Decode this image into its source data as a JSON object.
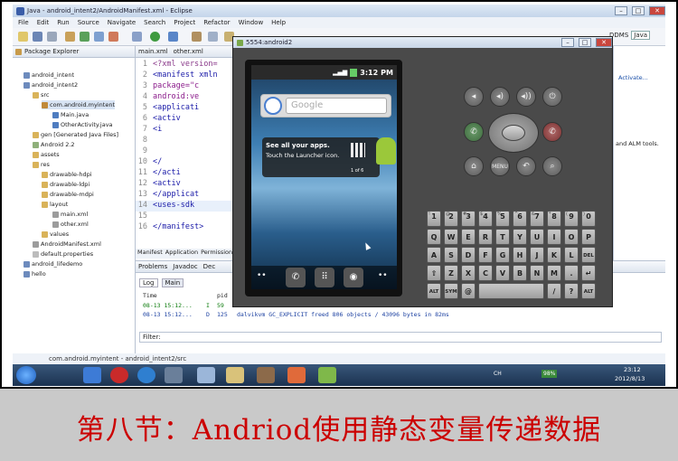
{
  "window": {
    "title": "Java - android_intent2/AndroidManifest.xml - Eclipse"
  },
  "menu": [
    "File",
    "Edit",
    "Run",
    "Source",
    "Navigate",
    "Search",
    "Project",
    "Refactor",
    "Window",
    "Help"
  ],
  "perspectives": {
    "ddms": "DDMS",
    "java": "Java"
  },
  "package_explorer": {
    "title": "Package Explorer",
    "items": [
      "android_intent",
      "android_intent2",
      "src",
      "com.android.myintent",
      "Main.java",
      "OtherActivity.java",
      "gen [Generated Java Files]",
      "Android 2.2",
      "assets",
      "res",
      "drawable-hdpi",
      "drawable-ldpi",
      "drawable-mdpi",
      "layout",
      "main.xml",
      "other.xml",
      "values",
      "AndroidManifest.xml",
      "default.properties",
      "android_lifedemo",
      "hello"
    ]
  },
  "editor": {
    "tabs": [
      "main.xml",
      "other.xml"
    ],
    "lines": [
      {
        "n": "1",
        "t": "<?xml version="
      },
      {
        "n": "2",
        "t": "<manifest xmln"
      },
      {
        "n": "3",
        "t": "    package=\"c"
      },
      {
        "n": "4",
        "t": "    android:ve"
      },
      {
        "n": "5",
        "t": "    <applicati"
      },
      {
        "n": "6",
        "t": "        <activ"
      },
      {
        "n": "7",
        "t": "            <i"
      },
      {
        "n": "8",
        "t": ""
      },
      {
        "n": "9",
        "t": ""
      },
      {
        "n": "10",
        "t": "            </"
      },
      {
        "n": "11",
        "t": "        </acti"
      },
      {
        "n": "12",
        "t": "        <activ"
      },
      {
        "n": "13",
        "t": "    </applicat"
      },
      {
        "n": "14",
        "t": "    <uses-sdk "
      },
      {
        "n": "15",
        "t": ""
      },
      {
        "n": "16",
        "t": "</manifest>"
      }
    ],
    "bottom_tabs": [
      "Manifest",
      "Application",
      "Permissions"
    ]
  },
  "console": {
    "tabs": [
      "Problems",
      "Javadoc",
      "Dec"
    ],
    "subtabs": [
      "Log",
      "Main"
    ],
    "headers": [
      "Time",
      "pid"
    ],
    "rows": [
      {
        "time": "08-13 15:12...",
        "lvl": "I",
        "pid": "59",
        "msg": ""
      },
      {
        "time": "08-13 15:12...",
        "lvl": "D",
        "pid": "125",
        "msg": "dalvikvm  GC_EXPLICIT freed 806 objects / 43096 bytes in 82ms"
      }
    ],
    "filter_label": "Filter:"
  },
  "right_panel": {
    "activate": "Activate...",
    "alm_text": "and ALM tools."
  },
  "emulator": {
    "title": "5554:android2",
    "clock": "3:12",
    "ampm": "PM",
    "search_text": "Google",
    "widget_title": "See all your apps.",
    "widget_sub": "Touch the Launcher icon.",
    "widget_page": "1 of 6",
    "keyboard": {
      "row1": [
        [
          "1",
          "!"
        ],
        [
          "2",
          "@"
        ],
        [
          "3",
          "#"
        ],
        [
          "4",
          "$"
        ],
        [
          "5",
          "%"
        ],
        [
          "6",
          "^"
        ],
        [
          "7",
          "&"
        ],
        [
          "8",
          "*"
        ],
        [
          "9",
          "("
        ],
        [
          "0",
          ")"
        ]
      ],
      "row2": [
        "Q",
        "W",
        "E",
        "R",
        "T",
        "Y",
        "U",
        "I",
        "O",
        "P"
      ],
      "row3": [
        "A",
        "S",
        "D",
        "F",
        "G",
        "H",
        "J",
        "K",
        "L",
        "DEL"
      ],
      "row4": [
        "⇧",
        "Z",
        "X",
        "C",
        "V",
        "B",
        "N",
        "M",
        ".",
        "↵"
      ],
      "row5": [
        "ALT",
        "SYM",
        "@",
        "",
        "",
        "",
        "",
        "/",
        "?",
        "ALT"
      ]
    },
    "menu_label": "MENU"
  },
  "statusline": {
    "text": "com.android.myintent - android_intent2/src"
  },
  "taskbar": {
    "time": "23:12",
    "date": "2012/8/13",
    "battery": "98%",
    "lang": "CH"
  },
  "caption": {
    "text": "第八节：Andriod使用静态变量传递数据"
  }
}
